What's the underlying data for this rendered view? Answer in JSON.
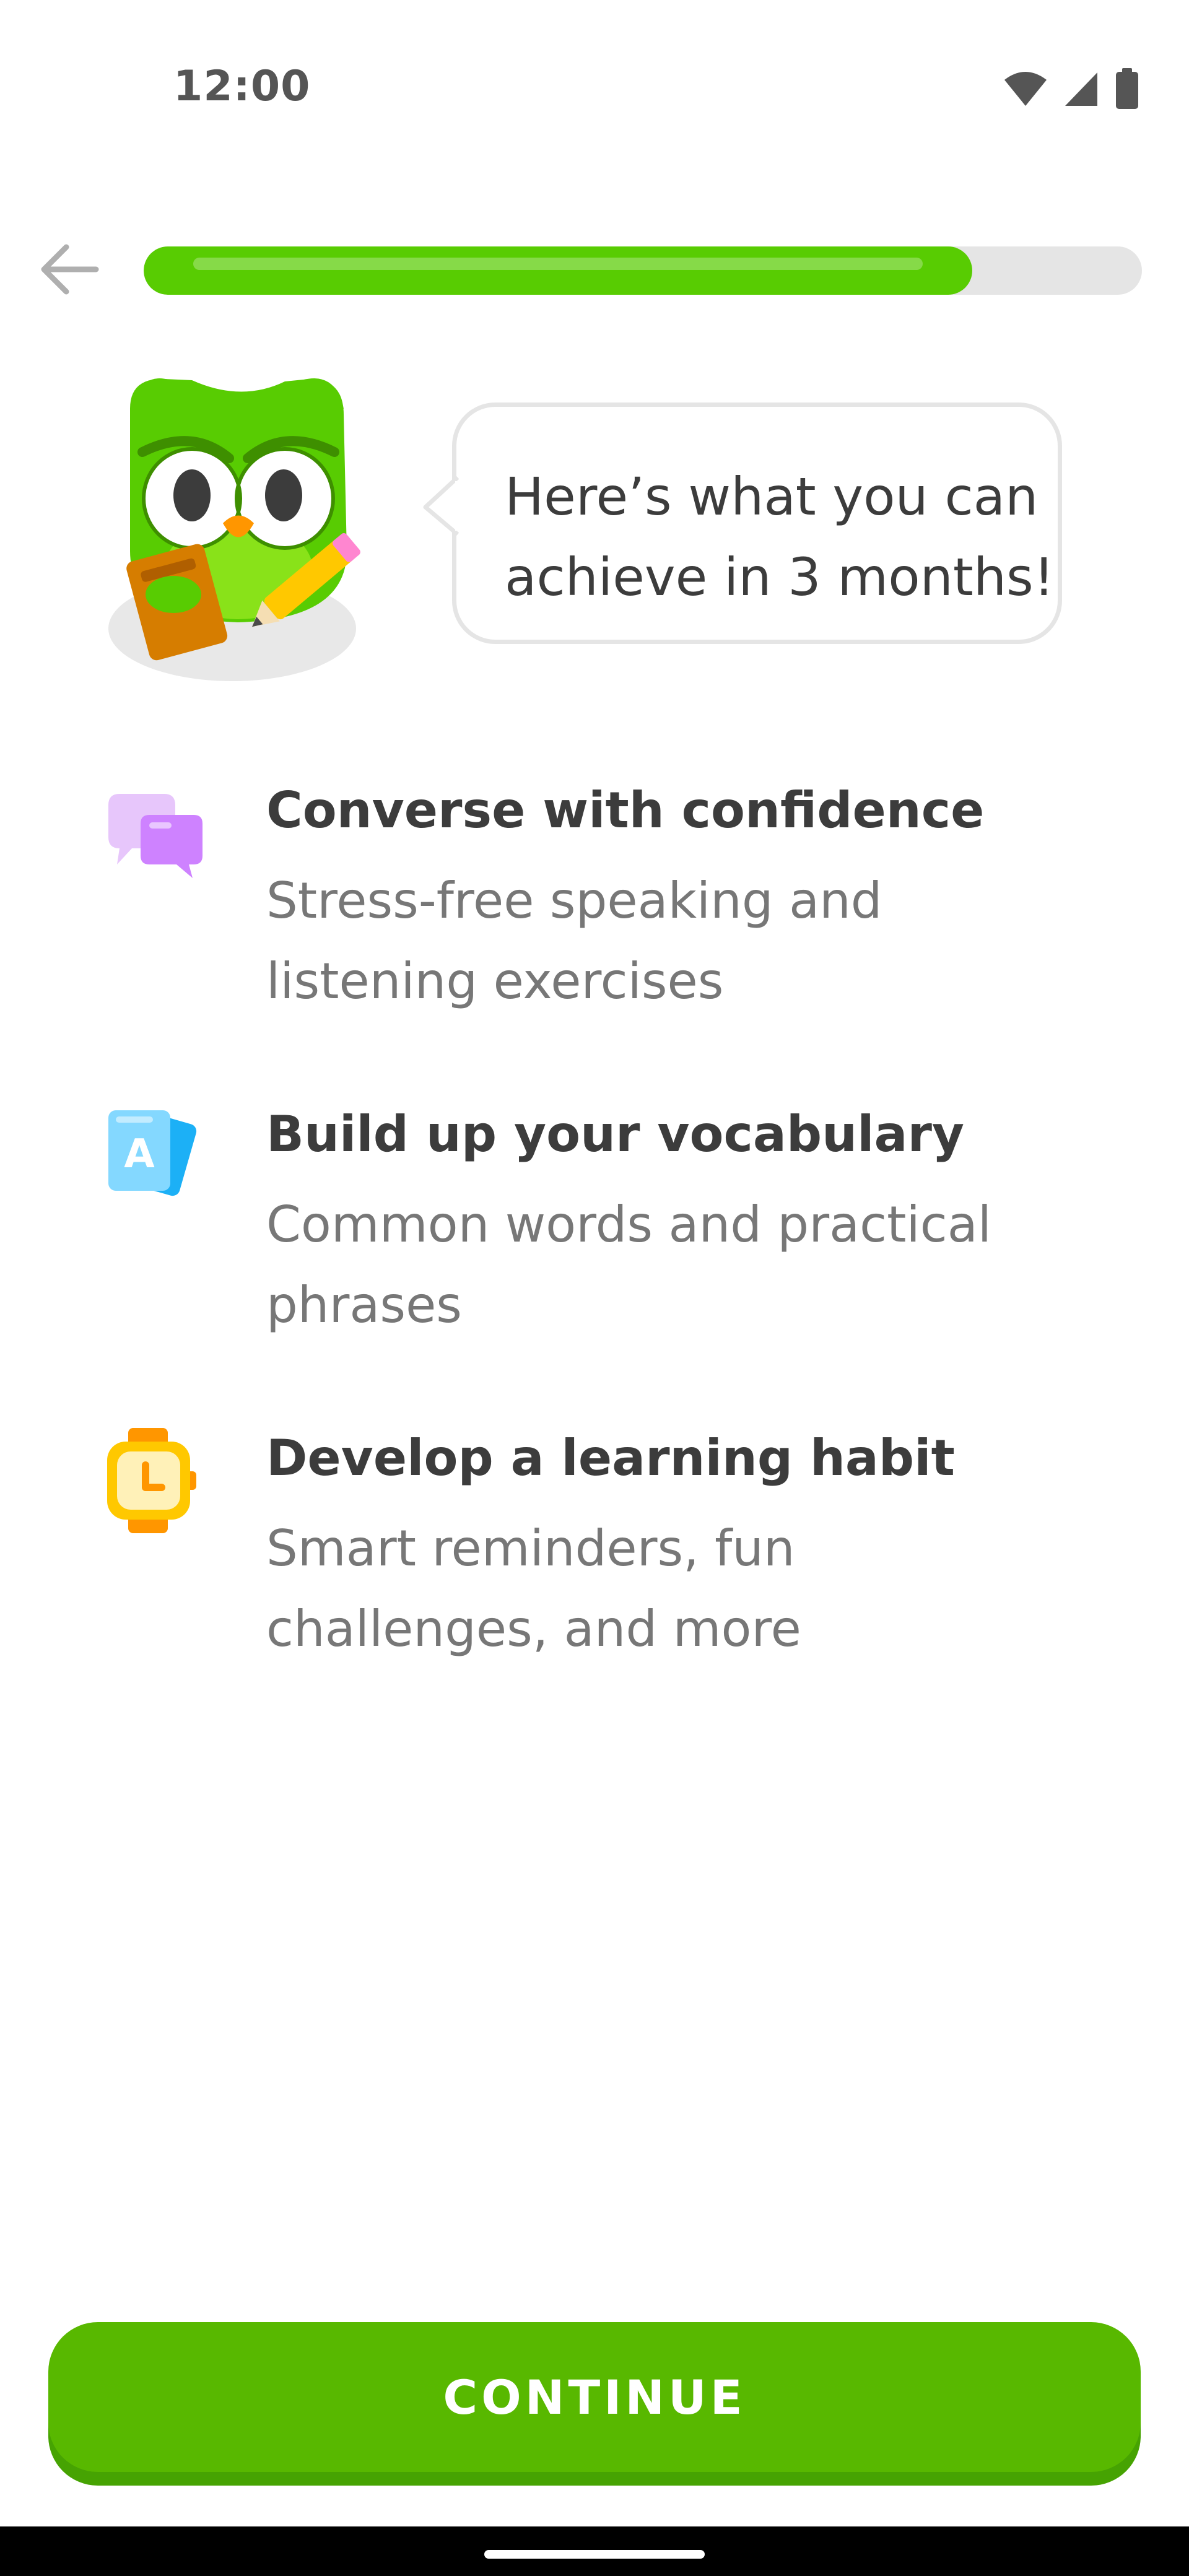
{
  "status_bar": {
    "time": "12:00",
    "icons": [
      "wifi-icon",
      "signal-icon",
      "battery-icon"
    ]
  },
  "nav": {
    "back_icon": "back-arrow-icon",
    "progress_fraction": 0.83
  },
  "hero": {
    "mascot": "owl-mascot",
    "speech": "Here’s what you can\nachieve in 3 months!"
  },
  "features": [
    {
      "icon": "chat-bubbles-icon",
      "title": "Converse with confidence",
      "description": "Stress-free speaking and listening exercises"
    },
    {
      "icon": "flashcards-icon",
      "title": "Build up your vocabulary",
      "description": "Common words and practical phrases"
    },
    {
      "icon": "watch-icon",
      "title": "Develop a learning habit",
      "description": "Smart reminders, fun challenges, and more"
    }
  ],
  "footer": {
    "continue_label": "CONTINUE"
  },
  "colors": {
    "brand_green": "#58cc02",
    "button_green": "#58b800",
    "button_shadow": "#46a302",
    "track_gray": "#e5e5e5",
    "title_text": "#3c3c3c",
    "body_text": "#777777"
  }
}
